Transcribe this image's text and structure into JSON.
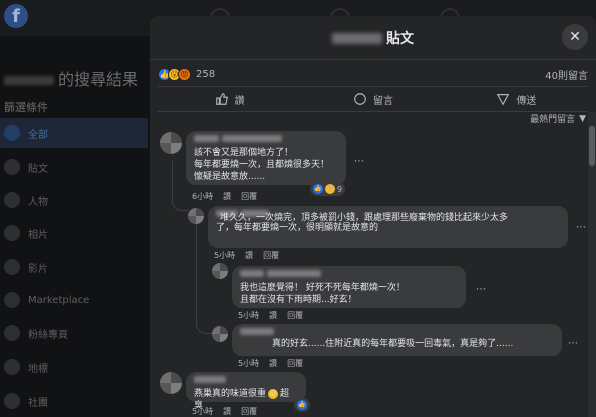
{
  "background": {
    "search_title_suffix": "的搜尋結果",
    "filter_header": "篩選條件",
    "sidebar_items": [
      {
        "label": "全部",
        "icon": "grid-icon",
        "active": true
      },
      {
        "label": "貼文",
        "icon": "posts-icon",
        "active": false
      },
      {
        "label": "人物",
        "icon": "people-icon",
        "active": false
      },
      {
        "label": "相片",
        "icon": "photos-icon",
        "active": false
      },
      {
        "label": "影片",
        "icon": "video-icon",
        "active": false
      },
      {
        "label": "Marketplace",
        "icon": "shop-icon",
        "active": false
      },
      {
        "label": "粉絲專頁",
        "icon": "flag-icon",
        "active": false
      },
      {
        "label": "地標",
        "icon": "pin-icon",
        "active": false
      },
      {
        "label": "社團",
        "icon": "groups-icon",
        "active": false
      }
    ]
  },
  "modal": {
    "title_suffix": "貼文",
    "close_label": "✕",
    "reaction_count": "258",
    "comment_count": "40則留言",
    "actions": {
      "like": "讚",
      "comment": "留言",
      "share": "傳送"
    },
    "sort_label": "最熱門留言"
  },
  "comments": [
    {
      "lines": [
        "該不會又是那個地方了！",
        "每年都要燒一次，且都燒很多天！",
        "懷疑是故意放......"
      ],
      "time": "6小時",
      "like": "讚",
      "reply": "回覆",
      "reactions": "9"
    },
    {
      "lines": [
        "堆久久，一次燒完，頂多被罰小錢，跟處理那些廢棄物的錢比起來少太多",
        "了，每年都要燒一次，很明顯就是故意的"
      ],
      "time": "5小時",
      "like": "讚",
      "reply": "回覆"
    },
    {
      "lines": [
        "我也這麼覺得！ 好死不死每年都燒一次！",
        "且都在沒有下雨時期...好玄！"
      ],
      "time": "5小時",
      "like": "讚",
      "reply": "回覆"
    },
    {
      "lines": [
        "真的好玄......住附近真的每年都要吸一回毒氣，真是夠了......"
      ],
      "time": "5小時",
      "like": "讚",
      "reply": "回覆"
    },
    {
      "lines": [
        "燕巢真的味道很重",
        "超臭"
      ],
      "time": "5小時",
      "like": "讚",
      "reply": "回覆"
    }
  ]
}
